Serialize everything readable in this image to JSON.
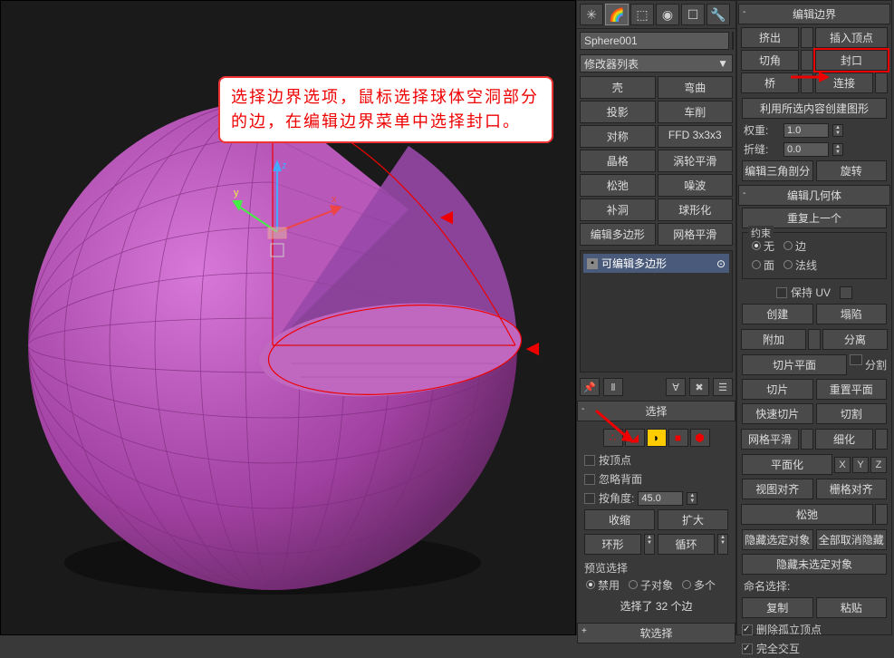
{
  "annotation": "选择边界选项，鼠标选择球体空洞部分的边，在编辑边界菜单中选择封口。",
  "object_name": "Sphere001",
  "modifier_dropdown": "修改器列表",
  "modifiers": [
    "壳",
    "弯曲",
    "投影",
    "车削",
    "对称",
    "FFD 3x3x3",
    "晶格",
    "涡轮平滑",
    "松弛",
    "噪波",
    "补洞",
    "球形化",
    "编辑多边形",
    "网格平滑"
  ],
  "stack_item": "可编辑多边形",
  "selection": {
    "title": "选择",
    "by_vertex": "按顶点",
    "ignore_backface": "忽略背面",
    "by_angle": "按角度:",
    "angle_val": "45.0",
    "shrink": "收缩",
    "grow": "扩大",
    "ring": "环形",
    "loop": "循环",
    "preview_label": "预览选择",
    "disable": "禁用",
    "sub_obj": "子对象",
    "multi": "多个",
    "status": "选择了 32 个边"
  },
  "soft_sel": "软选择",
  "edit_border": {
    "title": "编辑边界",
    "extrude": "挤出",
    "insert_vertex": "插入顶点",
    "chamfer": "切角",
    "cap": "封口",
    "bridge": "桥",
    "connect": "连接",
    "create_shape": "利用所选内容创建图形",
    "weight": "权重:",
    "weight_val": "1.0",
    "crease": "折缝:",
    "crease_val": "0.0",
    "edit_tri": "编辑三角剖分",
    "turn": "旋转"
  },
  "edit_geo": {
    "title": "编辑几何体",
    "repeat": "重复上一个",
    "constraints": "约束",
    "none": "无",
    "edge": "边",
    "face": "面",
    "normal": "法线",
    "preserve_uv": "保持 UV",
    "create": "创建",
    "collapse": "塌陷",
    "attach": "附加",
    "detach": "分离",
    "slice_plane": "切片平面",
    "split": "分割",
    "slice": "切片",
    "reset_plane": "重置平面",
    "quick_slice": "快速切片",
    "cut": "切割",
    "msmooth": "网格平滑",
    "tessellate": "细化",
    "planarize": "平面化",
    "view_align": "视图对齐",
    "grid_align": "栅格对齐",
    "relax": "松弛",
    "hide_sel": "隐藏选定对象",
    "unhide_all": "全部取消隐藏",
    "hide_unsel": "隐藏未选定对象",
    "named_sel": "命名选择:",
    "copy": "复制",
    "paste": "粘贴",
    "del_iso": "删除孤立顶点",
    "full_int": "完全交互"
  }
}
